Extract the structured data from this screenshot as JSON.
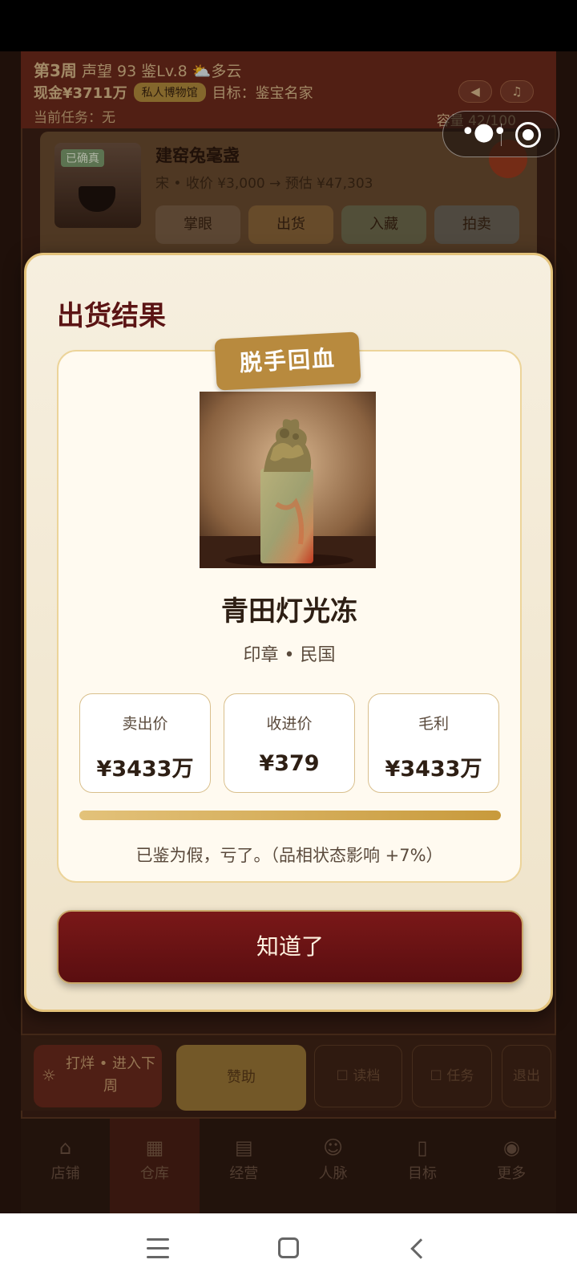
{
  "game": {
    "week": "第3周",
    "reputation": "声望 93",
    "appraisal_level": "鉴Lv.8",
    "weather": "⛅多云",
    "cash": "现金¥3711万",
    "museum_badge": "私人博物馆",
    "goal": "目标：鉴宝名家",
    "task": "当前任务：无",
    "capacity": "容量 42/100",
    "sound_icon": "speaker-icon",
    "music_icon": "music-icon"
  },
  "item_card": {
    "badge": "已确真",
    "name": "建窑兔毫盏",
    "meta": "宋 • 收价 ¥3,000 → 预估 ¥47,303",
    "actions": [
      "掌眼",
      "出货",
      "入藏",
      "拍卖"
    ]
  },
  "bottom_actions": {
    "advance": "打烊 • 进入下周",
    "sponsor": "赞助",
    "save": "☐ 读档",
    "tasks": "☐ 任务",
    "exit": "退出"
  },
  "tabs": [
    {
      "label": "店铺",
      "icon": "shop-icon"
    },
    {
      "label": "仓库",
      "icon": "warehouse-icon"
    },
    {
      "label": "经营",
      "icon": "business-icon"
    },
    {
      "label": "人脉",
      "icon": "people-icon"
    },
    {
      "label": "目标",
      "icon": "target-icon"
    },
    {
      "label": "更多",
      "icon": "more-icon"
    }
  ],
  "modal": {
    "title": "出货结果",
    "ribbon": "脱手回血",
    "item_name": "青田灯光冻",
    "item_meta": "印章 • 民国",
    "stats": [
      {
        "label": "卖出价",
        "value": "¥3433万"
      },
      {
        "label": "收进价",
        "value": "¥379"
      },
      {
        "label": "毛利",
        "value": "¥3433万"
      }
    ],
    "progress": 1.0,
    "verdict": "已鉴为假，亏了。（品相状态影响 +7%）",
    "confirm": "知道了"
  },
  "colors": {
    "accent_gold": "#c89a3c",
    "title_red": "#5b1414",
    "button_red": "#6a1214"
  }
}
